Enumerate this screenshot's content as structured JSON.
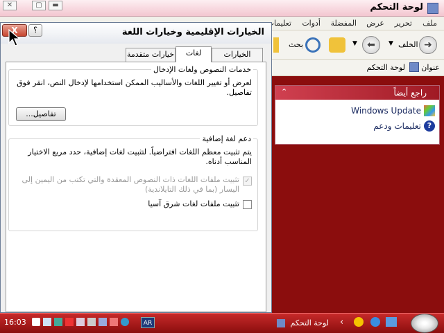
{
  "control_panel": {
    "title": "لوحة التحكم",
    "menu": [
      "ملف",
      "تحرير",
      "عرض",
      "المفضلة",
      "أدوات",
      "تعليمات"
    ],
    "toolbar": {
      "back": "الخلف",
      "search": "بحث"
    },
    "address": {
      "label": "عنوان",
      "value": "لوحة التحكم"
    },
    "see_also": {
      "title": "راجع أيضاً",
      "items": [
        "Windows Update",
        "تعليمات ودعم"
      ]
    }
  },
  "dialog": {
    "title": "الخيارات الإقليمية وخيارات اللغة",
    "help": "؟",
    "close": "X",
    "tabs": [
      "الخيارات الإقليمية",
      "لغات",
      "خيارات متقدمة"
    ],
    "active_tab": "لغات",
    "text_services": {
      "title": "خدمات النصوص ولغات الإدخال",
      "description": "لعرض أو تغيير اللغات والأساليب الممكن استخدامها لإدخال النص، انقر فوق تفاصيل.",
      "details_button": "تفاصيل..."
    },
    "supplemental": {
      "title": "دعم لغة إضافية",
      "description": "يتم تثبيت معظم اللغات افتراضياً. لتثبيت لغات إضافية، حدد مربع الاختيار المناسب أدناه.",
      "complex_scripts": "تثبيت ملفات اللغات ذات النصوص المعقدة والتي تكتب من اليمين إلى اليسار (بما في ذلك التايلاندية)",
      "complex_checked": true,
      "east_asian": "تثبيت ملفات لغات شرق آسيا",
      "east_asian_checked": false
    }
  },
  "taskbar": {
    "clock": "16:03",
    "language": "AR",
    "task": "لوحة التحكم",
    "chevron": "‹"
  },
  "colors": {
    "taskbar": "#b01e1e",
    "desktop": "#8b0d0d",
    "see_also_header": "#c0303c"
  }
}
